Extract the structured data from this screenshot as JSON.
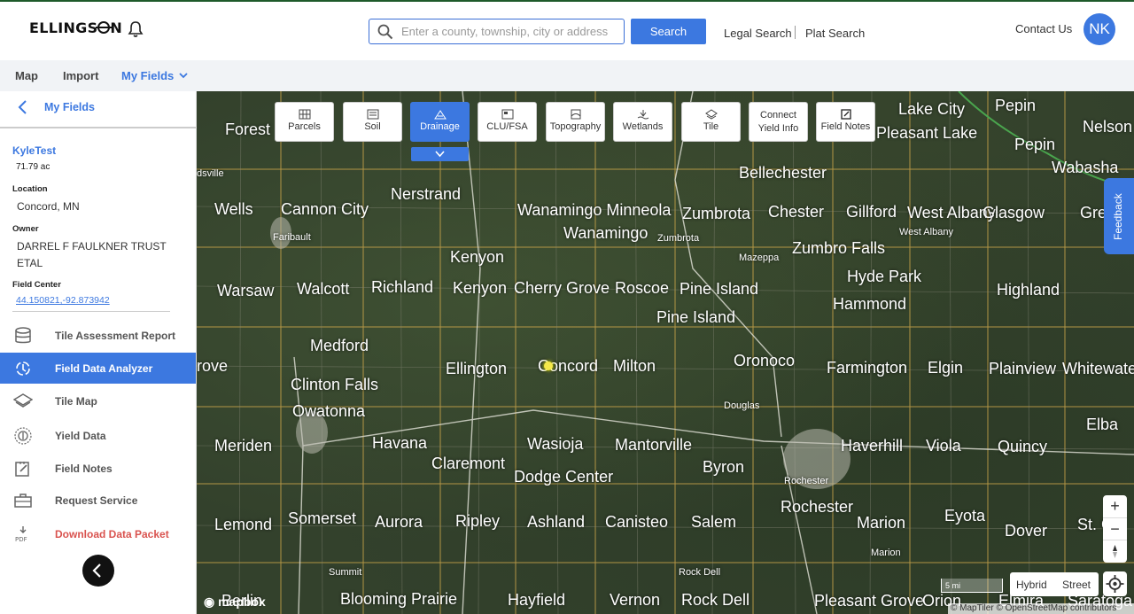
{
  "header": {
    "logo": "ELLINGS",
    "logo_tail": "N",
    "search_placeholder": "Enter a county, township, city or address",
    "search_button": "Search",
    "legal_search": "Legal Search",
    "plat_search": "Plat Search",
    "contact": "Contact Us",
    "avatar_initials": "NK"
  },
  "nav": {
    "items": [
      "Map",
      "Import",
      "My Fields"
    ],
    "active": "My Fields"
  },
  "sidebar": {
    "title": "My Fields",
    "field_name": "KyleTest",
    "acres": "71.79 ac",
    "location_label": "Location",
    "location": "Concord, MN",
    "owner_label": "Owner",
    "owner": "DARREL F FAULKNER TRUST ETAL",
    "center_label": "Field Center",
    "center": "44.150821,-92.873942",
    "menu": [
      {
        "label": "Tile Assessment Report",
        "icon": "database-icon"
      },
      {
        "label": "Field Data Analyzer",
        "icon": "analyzer-icon",
        "active": true
      },
      {
        "label": "Tile Map",
        "icon": "layers-icon"
      },
      {
        "label": "Yield Data",
        "icon": "yield-icon"
      },
      {
        "label": "Field Notes",
        "icon": "note-edit-icon"
      },
      {
        "label": "Request Service",
        "icon": "toolbox-icon"
      },
      {
        "label": "Download Data Packet",
        "icon": "pdf-icon",
        "danger": true
      }
    ]
  },
  "map": {
    "layers": [
      {
        "label": "Parcels",
        "icon": "grid-icon"
      },
      {
        "label": "Soil",
        "icon": "soil-icon"
      },
      {
        "label": "Drainage",
        "icon": "drainage-icon",
        "active": true
      },
      {
        "label": "CLU/FSA",
        "icon": "clu-icon"
      },
      {
        "label": "Topography",
        "icon": "topography-icon"
      },
      {
        "label": "Wetlands",
        "icon": "wetlands-icon"
      },
      {
        "label": "Tile",
        "icon": "tile-icon"
      },
      {
        "label": "Connect Yield Info",
        "icon": ""
      },
      {
        "label": "Field Notes",
        "icon": "note-edit-icon"
      }
    ],
    "feedback": "Feedback",
    "style_hybrid": "Hybrid",
    "style_street": "Street",
    "scale": "5 mi",
    "mapbox": "mapbox",
    "attribution": "© MapTiler © OpenStreetMap contributors",
    "towns": [
      {
        "name": "Forest",
        "size": "lg"
      },
      {
        "name": "Lake City",
        "size": "lg"
      },
      {
        "name": "Pepin",
        "size": "lg"
      },
      {
        "name": "Nelson",
        "size": "lg"
      },
      {
        "name": "Pleasant Lake",
        "size": "lg"
      },
      {
        "name": "Pepin",
        "size": "lg"
      },
      {
        "name": "Wabasha",
        "size": "lg"
      },
      {
        "name": "Bellechester",
        "size": "lg"
      },
      {
        "name": "dsville",
        "size": "sm"
      },
      {
        "name": "Nerstrand",
        "size": "lg"
      },
      {
        "name": "Wells",
        "size": "lg"
      },
      {
        "name": "Cannon City",
        "size": "lg"
      },
      {
        "name": "Wanamingo Minneola",
        "size": "lg"
      },
      {
        "name": "Zumbrota",
        "size": "lg"
      },
      {
        "name": "Chester",
        "size": "lg"
      },
      {
        "name": "Gillford",
        "size": "lg"
      },
      {
        "name": "West Albany",
        "size": "lg"
      },
      {
        "name": "Glasgow",
        "size": "lg"
      },
      {
        "name": "Gre",
        "size": "lg"
      },
      {
        "name": "Faribault",
        "size": "sm"
      },
      {
        "name": "Wanamingo",
        "size": "lg"
      },
      {
        "name": "Zumbrota",
        "size": "sm"
      },
      {
        "name": "West Albany",
        "size": "sm"
      },
      {
        "name": "Zumbro Falls",
        "size": "lg"
      },
      {
        "name": "Kenyon",
        "size": "lg"
      },
      {
        "name": "Mazeppa",
        "size": "sm"
      },
      {
        "name": "Hyde Park",
        "size": "lg"
      },
      {
        "name": "Warsaw",
        "size": "lg"
      },
      {
        "name": "Walcott",
        "size": "lg"
      },
      {
        "name": "Richland",
        "size": "lg"
      },
      {
        "name": "Kenyon",
        "size": "lg"
      },
      {
        "name": "Cherry Grove",
        "size": "lg"
      },
      {
        "name": "Roscoe",
        "size": "lg"
      },
      {
        "name": "Pine Island",
        "size": "lg"
      },
      {
        "name": "Highland",
        "size": "lg"
      },
      {
        "name": "Hammond",
        "size": "lg"
      },
      {
        "name": "Pine Island",
        "size": "lg"
      },
      {
        "name": "Medford",
        "size": "lg"
      },
      {
        "name": "rove",
        "size": "lg"
      },
      {
        "name": "Ellington",
        "size": "lg"
      },
      {
        "name": "Concord",
        "size": "lg"
      },
      {
        "name": "Milton",
        "size": "lg"
      },
      {
        "name": "Oronoco",
        "size": "lg"
      },
      {
        "name": "Farmington",
        "size": "lg"
      },
      {
        "name": "Elgin",
        "size": "lg"
      },
      {
        "name": "Plainview",
        "size": "lg"
      },
      {
        "name": "Whitewate",
        "size": "lg"
      },
      {
        "name": "Clinton Falls",
        "size": "lg"
      },
      {
        "name": "Owatonna",
        "size": "lg"
      },
      {
        "name": "Douglas",
        "size": "sm"
      },
      {
        "name": "Elba",
        "size": "lg"
      },
      {
        "name": "Havana",
        "size": "lg"
      },
      {
        "name": "Meriden",
        "size": "lg"
      },
      {
        "name": "Wasioja",
        "size": "lg"
      },
      {
        "name": "Mantorville",
        "size": "lg"
      },
      {
        "name": "Haverhill",
        "size": "lg"
      },
      {
        "name": "Viola",
        "size": "lg"
      },
      {
        "name": "Quincy",
        "size": "lg"
      },
      {
        "name": "Claremont",
        "size": "lg"
      },
      {
        "name": "Byron",
        "size": "lg"
      },
      {
        "name": "Dodge Center",
        "size": "lg"
      },
      {
        "name": "Rochester",
        "size": "sm"
      },
      {
        "name": "Rochester",
        "size": "lg"
      },
      {
        "name": "Eyota",
        "size": "lg"
      },
      {
        "name": "Lemond",
        "size": "lg"
      },
      {
        "name": "Somerset",
        "size": "lg"
      },
      {
        "name": "Aurora",
        "size": "lg"
      },
      {
        "name": "Ripley",
        "size": "lg"
      },
      {
        "name": "Ashland",
        "size": "lg"
      },
      {
        "name": "Canisteo",
        "size": "lg"
      },
      {
        "name": "Salem",
        "size": "lg"
      },
      {
        "name": "Marion",
        "size": "lg"
      },
      {
        "name": "Dover",
        "size": "lg"
      },
      {
        "name": "St. C",
        "size": "lg"
      },
      {
        "name": "Marion",
        "size": "sm"
      },
      {
        "name": "Summit",
        "size": "sm"
      },
      {
        "name": "Rock Dell",
        "size": "sm"
      },
      {
        "name": "Blooming Prairie",
        "size": "lg"
      },
      {
        "name": "Hayfield",
        "size": "lg"
      },
      {
        "name": "Vernon",
        "size": "lg"
      },
      {
        "name": "Rock Dell",
        "size": "lg"
      },
      {
        "name": "Pleasant Grove",
        "size": "lg"
      },
      {
        "name": "Orion",
        "size": "lg"
      },
      {
        "name": "Elmira",
        "size": "lg"
      },
      {
        "name": "Saratoga",
        "size": "lg"
      },
      {
        "name": "Berlin",
        "size": "lg"
      }
    ]
  }
}
